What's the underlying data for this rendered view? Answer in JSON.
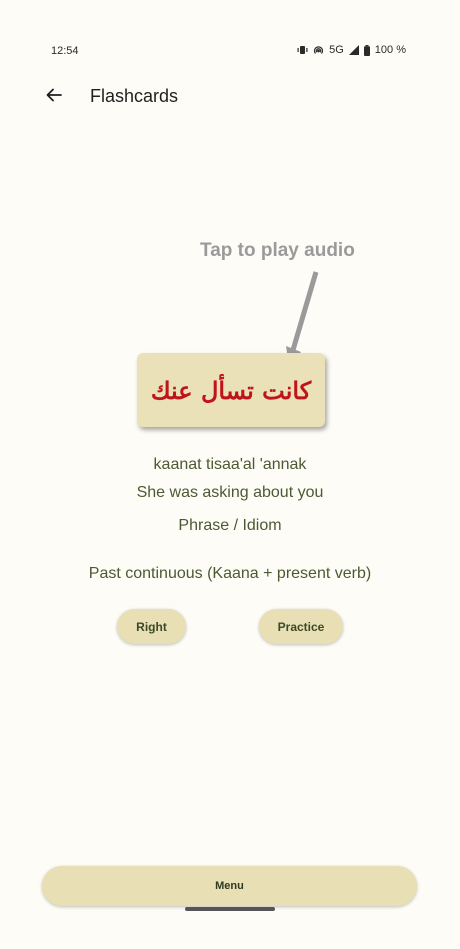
{
  "status_bar": {
    "time": "12:54",
    "network": "5G",
    "battery": "100 %"
  },
  "app_bar": {
    "title": "Flashcards"
  },
  "hint": "Tap to play audio",
  "card": {
    "arabic": "كانت تسأل عنك"
  },
  "details": {
    "transliteration": "kaanat tisaa'al 'annak",
    "meaning": "She was asking about you",
    "category": "Phrase / Idiom",
    "grammar": "Past continuous (Kaana + present verb)"
  },
  "buttons": {
    "right": "Right",
    "practice": "Practice",
    "menu": "Menu"
  },
  "colors": {
    "card_bg": "#EAE1B8",
    "arabic_text": "#C0141C",
    "detail_text": "#4b5a33",
    "button_bg": "#E8DFB4"
  }
}
